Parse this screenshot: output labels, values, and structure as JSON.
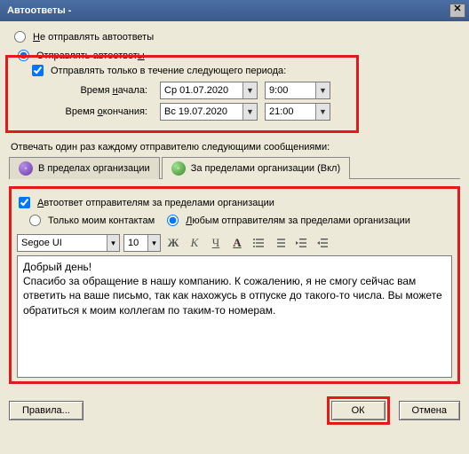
{
  "window": {
    "title": "Автоответы -"
  },
  "options": {
    "dont_send": "Не отправлять автоответы",
    "send": "Отправлять автоответы",
    "period_check": "Отправлять только в течение следующего периода:",
    "start_label": "Время начала:",
    "end_label": "Время окончания:",
    "start_date": "Ср 01.07.2020",
    "start_time": "9:00",
    "end_date": "Вс 19.07.2020",
    "end_time": "21:00"
  },
  "reply_caption": "Отвечать один раз каждому отправителю следующими сообщениями:",
  "tabs": {
    "inside": "В пределах организации",
    "outside": "За пределами организации (Вкл)"
  },
  "outside": {
    "enable": "Автоответ отправителям за пределами организации",
    "only_contacts": "Только моим контактам",
    "any_senders": "Любым отправителям за пределами организации"
  },
  "toolbar": {
    "font": "Segoe UI",
    "size": "10",
    "bold": "Ж",
    "italic": "К",
    "underline": "Ч",
    "fontcolor": "A"
  },
  "message": "Добрый день!\nСпасибо за обращение в нашу компанию. К сожалению, я не смогу сейчас вам ответить на ваше письмо, так как нахожусь в отпуске до такого-то числа. Вы можете обратиться к моим коллегам по таким-то номерам.",
  "footer": {
    "rules": "Правила...",
    "ok": "ОК",
    "cancel": "Отмена"
  }
}
